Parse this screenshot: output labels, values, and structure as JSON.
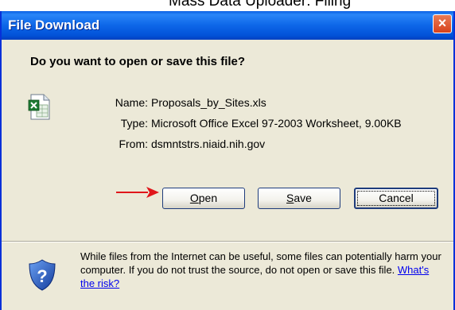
{
  "page_top": {
    "text": "Mass Data Uploader: Filing"
  },
  "dialog": {
    "title": "File Download",
    "close_glyph": "×",
    "heading": "Do you want to open or save this file?",
    "file": {
      "icon": "excel-file-icon",
      "name_label": "Name:",
      "name_value": "Proposals_by_Sites.xls",
      "type_label": "Type:",
      "type_value": "Microsoft Office Excel 97-2003 Worksheet, 9.00KB",
      "from_label": "From:",
      "from_value": "dsmntstrs.niaid.nih.gov"
    },
    "buttons": {
      "open_mnemonic": "O",
      "open_rest": "pen",
      "save_mnemonic": "S",
      "save_rest": "ave",
      "cancel_label": "Cancel"
    },
    "warning": {
      "icon": "shield-question-icon",
      "text": "While files from the Internet can be useful, some files can potentially harm your computer. If you do not trust the source, do not open or save this file. ",
      "link": "What's the risk?"
    }
  },
  "annotation": {
    "arrow_color": "#e0161b"
  },
  "colors": {
    "titlebar": "#0a5fe3",
    "dialog_bg": "#ece9d8",
    "close_button": "#d8421b",
    "link": "#0000ee"
  }
}
